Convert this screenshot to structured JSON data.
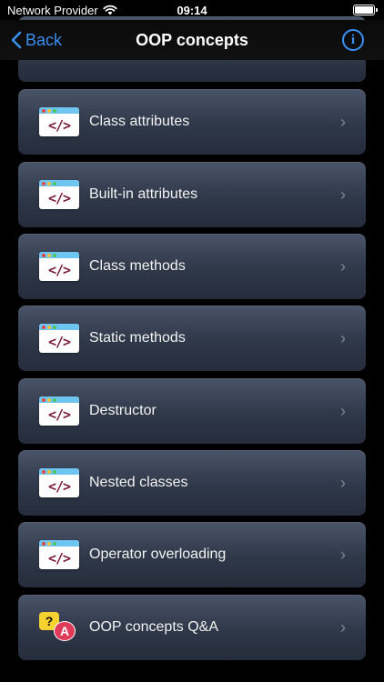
{
  "status_bar": {
    "carrier": "Network Provider",
    "time": "09:14"
  },
  "nav": {
    "back_label": "Back",
    "title": "OOP concepts",
    "info_glyph": "i"
  },
  "items": [
    {
      "label": "Class attributes",
      "icon": "code-window-icon"
    },
    {
      "label": "Built-in attributes",
      "icon": "code-window-icon"
    },
    {
      "label": "Class methods",
      "icon": "code-window-icon"
    },
    {
      "label": "Static methods",
      "icon": "code-window-icon"
    },
    {
      "label": "Destructor",
      "icon": "code-window-icon"
    },
    {
      "label": "Nested classes",
      "icon": "code-window-icon"
    },
    {
      "label": "Operator overloading",
      "icon": "code-window-icon"
    },
    {
      "label": "OOP concepts Q&A",
      "icon": "qa-icon"
    }
  ],
  "icon_text": {
    "code": "</>",
    "q": "?",
    "a": "A"
  },
  "colors": {
    "accent": "#3a8ff5",
    "background": "#000000",
    "card": "#2f3849"
  }
}
